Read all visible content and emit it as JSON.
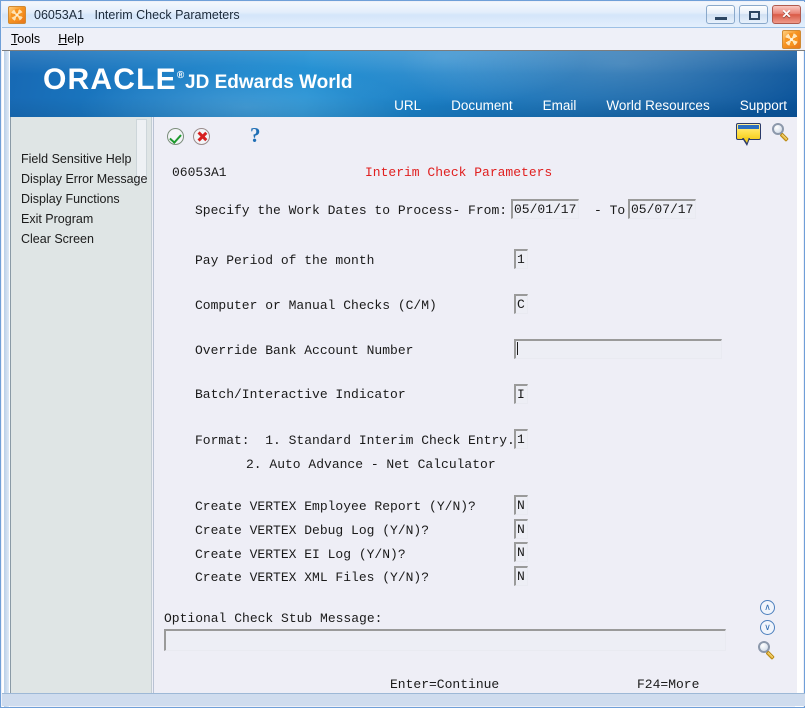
{
  "window": {
    "title_code": "06053A1",
    "title_text": "Interim Check Parameters",
    "minimize_label": "–",
    "maximize_label": "□",
    "close_label": "✕",
    "app_icon": "oracle-pinwheel-icon"
  },
  "menubar": {
    "items": [
      {
        "label": "Tools",
        "mnemonic": "T"
      },
      {
        "label": "Help",
        "mnemonic": "H"
      }
    ],
    "right_icon": "oracle-pinwheel-icon"
  },
  "banner": {
    "brand": "ORACLE",
    "brand_mark": "®",
    "product": "JD Edwards World",
    "links": [
      "URL",
      "Document",
      "Email",
      "World Resources",
      "Support"
    ],
    "bg_color": "#1878bf"
  },
  "sidebar": {
    "items": [
      {
        "label": "Field Sensitive Help"
      },
      {
        "label": "Display Error Message"
      },
      {
        "label": "Display Functions"
      },
      {
        "label": "Exit Program"
      },
      {
        "label": "Clear Screen"
      }
    ],
    "bg_color": "#dfe5e5"
  },
  "toolbar": {
    "ok_icon": "check-circle-icon",
    "cancel_icon": "cancel-circle-icon",
    "help_icon": "question-mark-icon",
    "note_icon": "note-callout-icon",
    "search_icon": "magnifier-icon"
  },
  "form": {
    "program_id": "06053A1",
    "title": "Interim Check Parameters",
    "title_color": "#e02020",
    "fields": {
      "dates_label": "Specify the Work Dates to Process- From:",
      "date_from": "05/01/17",
      "dates_separator": "- To:",
      "date_to": "05/07/17",
      "pay_period_label": "Pay Period of the month",
      "pay_period_value": "1",
      "checks_label": "Computer or Manual Checks (C/M)",
      "checks_value": "C",
      "bank_label": "Override Bank Account Number",
      "bank_value": "",
      "batch_label": "Batch/Interactive Indicator",
      "batch_value": "I",
      "format_label_1": "Format:  1. Standard Interim Check Entry.",
      "format_label_2": "2. Auto Advance - Net Calculator",
      "format_value": "1",
      "vertex_employee_label": "Create VERTEX Employee Report (Y/N)?",
      "vertex_employee_value": "N",
      "vertex_debug_label": "Create VERTEX Debug Log (Y/N)?",
      "vertex_debug_value": "N",
      "vertex_ei_label": "Create VERTEX EI Log (Y/N)?",
      "vertex_ei_value": "N",
      "vertex_xml_label": "Create VERTEX XML Files (Y/N)?",
      "vertex_xml_value": "N",
      "stub_label": "Optional Check Stub Message:",
      "stub_value": ""
    }
  },
  "footer": {
    "enter_hint": "Enter=Continue",
    "f24_hint": "F24=More"
  },
  "side_nav": {
    "up_label": "∧",
    "down_label": "∨",
    "search_icon": "magnifier-icon"
  }
}
